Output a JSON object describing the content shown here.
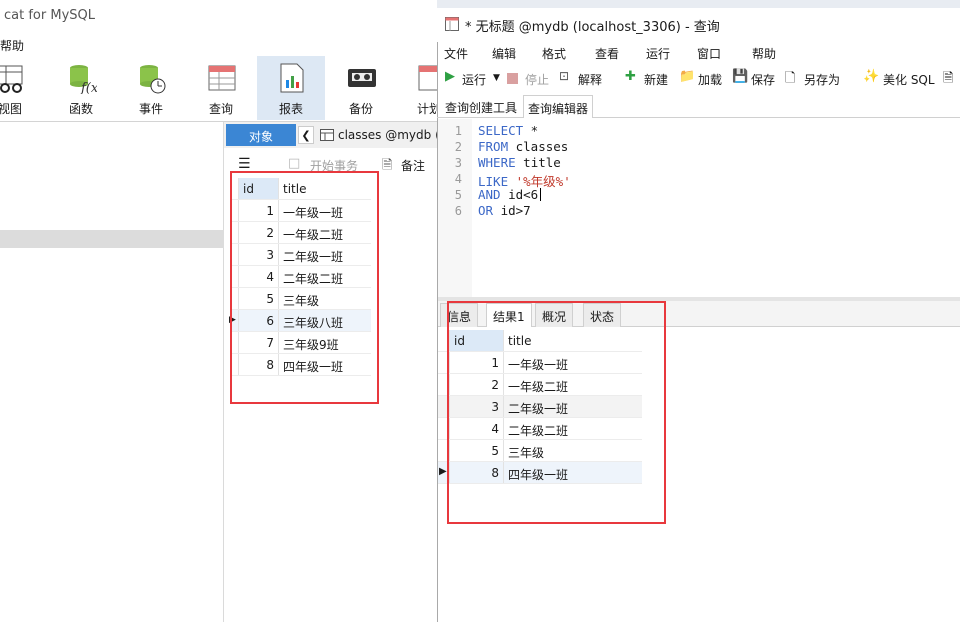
{
  "back_window": {
    "title": "cat for MySQL",
    "menu_item": "帮助",
    "toolbar": [
      {
        "label": "视图",
        "icon": "view-icon"
      },
      {
        "label": "函数",
        "icon": "function-icon"
      },
      {
        "label": "事件",
        "icon": "event-icon"
      },
      {
        "label": "查询",
        "icon": "query-icon"
      },
      {
        "label": "报表",
        "icon": "report-icon"
      },
      {
        "label": "备份",
        "icon": "backup-icon"
      },
      {
        "label": "计划",
        "icon": "schedule-icon"
      }
    ],
    "tabs": {
      "objects": "对象",
      "classes": "classes @mydb ("
    },
    "grid_toolbar": {
      "begin_transaction": "开始事务",
      "notes": "备注"
    },
    "table": {
      "headers": [
        "id",
        "title"
      ],
      "rows": [
        [
          "1",
          "一年级一班"
        ],
        [
          "2",
          "一年级二班"
        ],
        [
          "3",
          "二年级一班"
        ],
        [
          "4",
          "二年级二班"
        ],
        [
          "5",
          "三年级"
        ],
        [
          "6",
          "三年级八班"
        ],
        [
          "7",
          "三年级9班"
        ],
        [
          "8",
          "四年级一班"
        ]
      ]
    }
  },
  "query_window": {
    "title": "* 无标题 @mydb (localhost_3306) - 查询",
    "menu": [
      "文件",
      "编辑",
      "格式",
      "查看",
      "运行",
      "窗口",
      "帮助"
    ],
    "toolbar": {
      "run": "运行",
      "stop": "停止",
      "explain": "解释",
      "new": "新建",
      "load": "加载",
      "save": "保存",
      "save_as": "另存为",
      "beautify": "美化 SQL"
    },
    "tabs": [
      "查询创建工具",
      "查询编辑器"
    ],
    "line_numbers": [
      "1",
      "2",
      "3",
      "4",
      "5",
      "6"
    ],
    "sql": {
      "l1_kw": "SELECT",
      "l1_rest": " *",
      "l2_kw": "FROM",
      "l2_rest": " classes",
      "l3_kw": "WHERE",
      "l3_rest": " title",
      "l4_kw": "LIKE",
      "l4_str": " '%年级%'",
      "l5_kw": "AND",
      "l5_rest": " id<6",
      "l6_kw": "OR",
      "l6_rest": " id>7"
    },
    "result_tabs": [
      "信息",
      "结果1",
      "概况",
      "状态"
    ],
    "result_table": {
      "headers": [
        "id",
        "title"
      ],
      "rows": [
        [
          "1",
          "一年级一班"
        ],
        [
          "2",
          "一年级二班"
        ],
        [
          "3",
          "二年级一班"
        ],
        [
          "4",
          "二年级二班"
        ],
        [
          "5",
          "三年级"
        ],
        [
          "8",
          "四年级一班"
        ]
      ]
    }
  },
  "colors": {
    "annotation_red": "#e8383d",
    "sql_keyword": "#3c68c7",
    "sql_string": "#c0392b",
    "active_tab": "#3b86d4"
  }
}
